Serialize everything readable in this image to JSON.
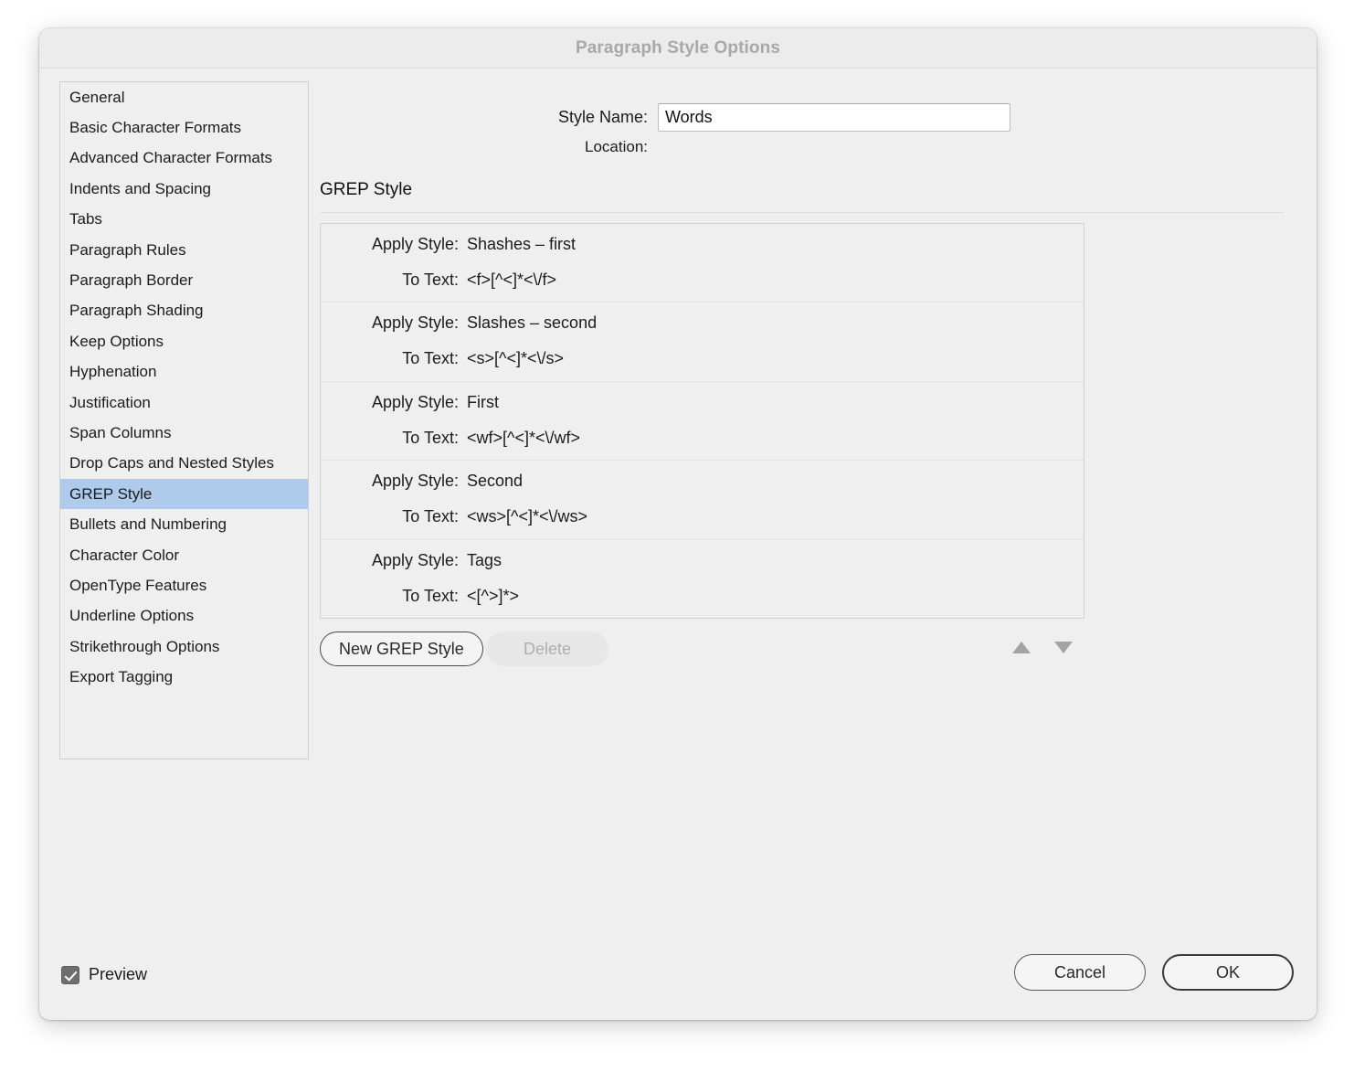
{
  "window": {
    "title": "Paragraph Style Options"
  },
  "sidebar": {
    "items": [
      {
        "label": "General",
        "selected": false
      },
      {
        "label": "Basic Character Formats",
        "selected": false
      },
      {
        "label": "Advanced Character Formats",
        "selected": false
      },
      {
        "label": "Indents and Spacing",
        "selected": false
      },
      {
        "label": "Tabs",
        "selected": false
      },
      {
        "label": "Paragraph Rules",
        "selected": false
      },
      {
        "label": "Paragraph Border",
        "selected": false
      },
      {
        "label": "Paragraph Shading",
        "selected": false
      },
      {
        "label": "Keep Options",
        "selected": false
      },
      {
        "label": "Hyphenation",
        "selected": false
      },
      {
        "label": "Justification",
        "selected": false
      },
      {
        "label": "Span Columns",
        "selected": false
      },
      {
        "label": "Drop Caps and Nested Styles",
        "selected": false
      },
      {
        "label": "GREP Style",
        "selected": true
      },
      {
        "label": "Bullets and Numbering",
        "selected": false
      },
      {
        "label": "Character Color",
        "selected": false
      },
      {
        "label": "OpenType Features",
        "selected": false
      },
      {
        "label": "Underline Options",
        "selected": false
      },
      {
        "label": "Strikethrough Options",
        "selected": false
      },
      {
        "label": "Export Tagging",
        "selected": false
      }
    ],
    "selection_color": "#aecbeb"
  },
  "header": {
    "style_name_label": "Style Name:",
    "style_name_value": "Words",
    "style_name_placeholder": "",
    "location_label": "Location:",
    "location_value": ""
  },
  "main": {
    "section_title": "GREP Style",
    "apply_style_label": "Apply Style:",
    "to_text_label": "To Text:",
    "rules": [
      {
        "apply_style": "Shashes – first",
        "to_text": "<f>[^<]*<\\/f>"
      },
      {
        "apply_style": "Slashes – second",
        "to_text": "<s>[^<]*<\\/s>"
      },
      {
        "apply_style": "First",
        "to_text": "<wf>[^<]*<\\/wf>"
      },
      {
        "apply_style": "Second",
        "to_text": "<ws>[^<]*<\\/ws>"
      },
      {
        "apply_style": "Tags",
        "to_text": "<[^>]*>"
      }
    ]
  },
  "list_toolbar": {
    "new_grep_style_label": "New GREP Style",
    "delete_label": "Delete",
    "delete_enabled": false,
    "move_up_icon": "triangle-up-icon",
    "move_down_icon": "triangle-down-icon"
  },
  "footer": {
    "preview_label": "Preview",
    "preview_checked": true,
    "cancel_label": "Cancel",
    "ok_label": "OK"
  }
}
